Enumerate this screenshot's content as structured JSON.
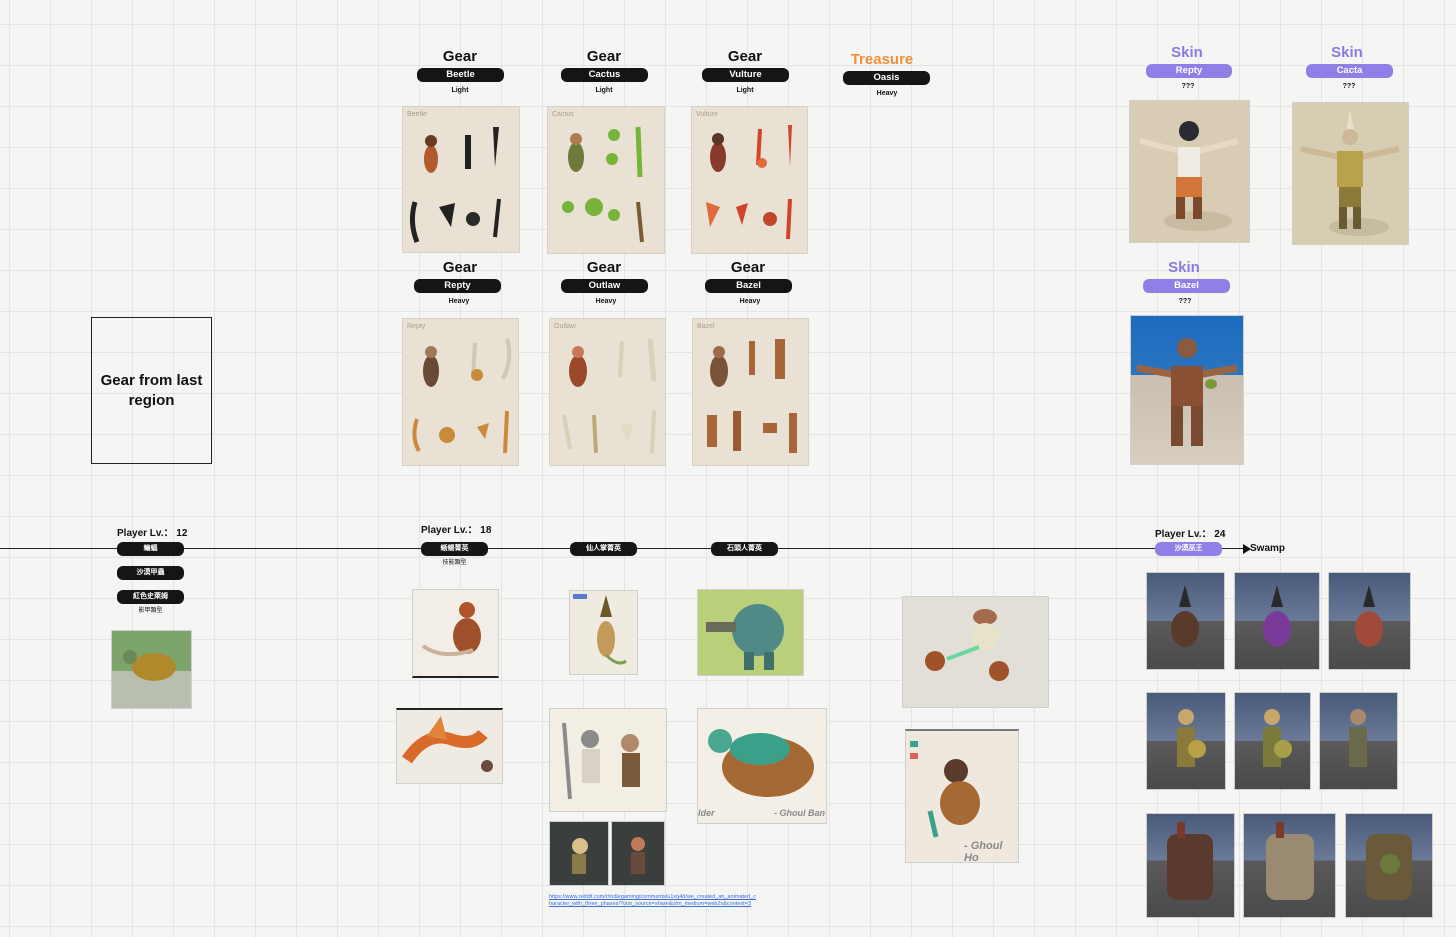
{
  "gear_headers": [
    {
      "title": "Gear",
      "name": "Beetle",
      "weight": "Light"
    },
    {
      "title": "Gear",
      "name": "Cactus",
      "weight": "Light"
    },
    {
      "title": "Gear",
      "name": "Vulture",
      "weight": "Light"
    },
    {
      "title": "Treasure",
      "name": "Oasis",
      "weight": "Heavy"
    },
    {
      "title": "Gear",
      "name": "Repty",
      "weight": "Heavy"
    },
    {
      "title": "Gear",
      "name": "Outlaw",
      "weight": "Heavy"
    },
    {
      "title": "Gear",
      "name": "Bazel",
      "weight": "Heavy"
    }
  ],
  "skins": [
    {
      "title": "Skin",
      "name": "Repty",
      "note": "???"
    },
    {
      "title": "Skin",
      "name": "Cacta",
      "note": "???"
    },
    {
      "title": "Skin",
      "name": "Bazel",
      "note": "???"
    }
  ],
  "card_labels": [
    "Beetle",
    "Cactus",
    "Vulture",
    "Repty",
    "Outlaw",
    "Bazel"
  ],
  "gear_from_last_region": "Gear from last region",
  "timeline": {
    "player_levels": [
      "Player Lv.： 12",
      "Player Lv.： 18",
      "Player Lv.： 24"
    ],
    "pills": [
      "蝙蝠",
      "沙漠甲蟲",
      "紅色史萊姆",
      "蜥蜴菁英",
      "仙人掌菁英",
      "石頭人菁英",
      "沙漠巫王"
    ],
    "notes": [
      "影甲類型",
      "技能類型"
    ],
    "end_label": "Swamp"
  },
  "image_captions": [
    "lder",
    "- Ghoul Ban",
    "- Ghoul Ho"
  ],
  "link_text": "https://www.reddit.com/r/indiegaming/comments/u1xq4d/we_created_an_animated_character_with_three_phases/?utm_source=share&utm_medium=web2x&context=3"
}
